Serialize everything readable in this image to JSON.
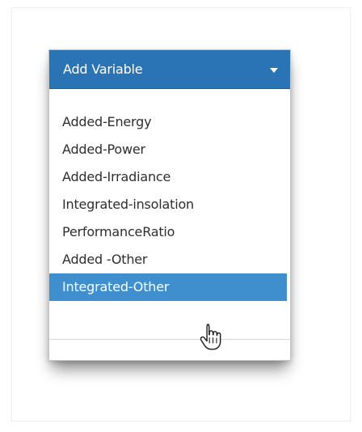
{
  "dropdown": {
    "title": "Add Variable",
    "header_color": "#2a73b4",
    "selected_color": "#3f8fcf",
    "items": [
      {
        "label": "Added-Energy"
      },
      {
        "label": "Added-Power"
      },
      {
        "label": "Added-Irradiance"
      },
      {
        "label": "Integrated-insolation"
      },
      {
        "label": "PerformanceRatio"
      },
      {
        "label": "Added -Other"
      },
      {
        "label": "Integrated-Other",
        "selected": true
      }
    ]
  },
  "icons": {
    "caret": "caret-down-icon",
    "cursor": "hand-pointer-icon"
  }
}
